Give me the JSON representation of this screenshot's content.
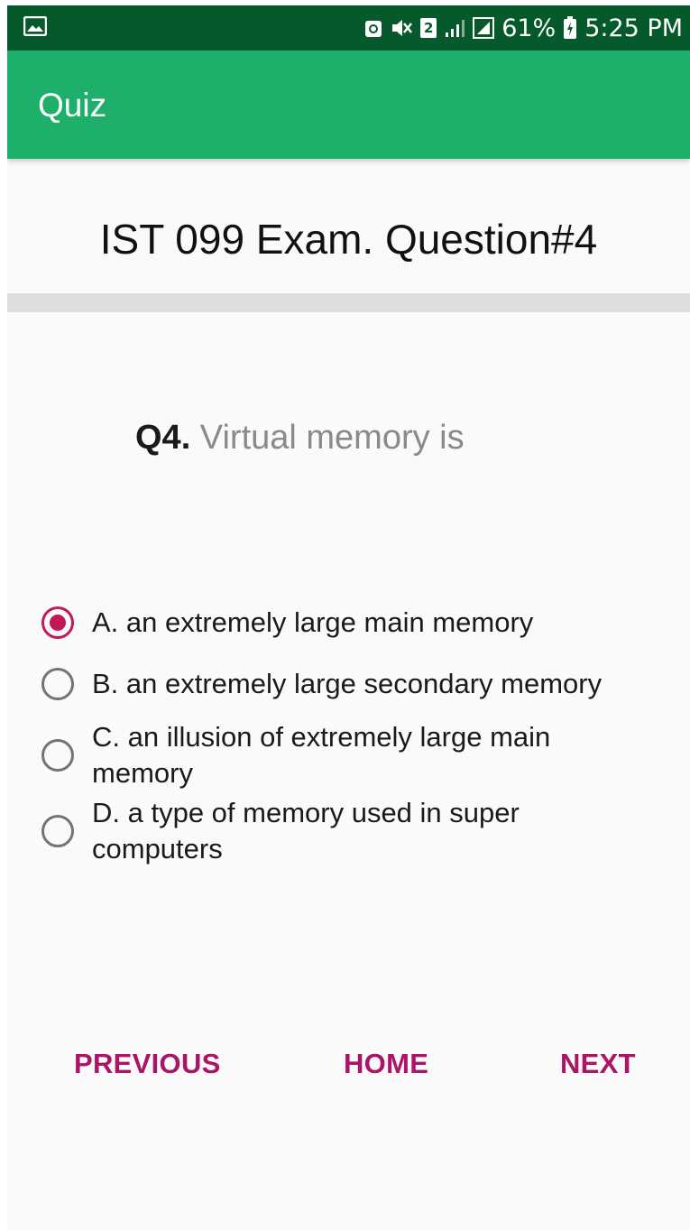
{
  "status_bar": {
    "battery": "61%",
    "time": "5:25 PM",
    "sim_badge": "2",
    "icons": [
      "image-icon",
      "recycle-icon",
      "mute-icon",
      "sim-icon",
      "signal-icon",
      "data-signal-icon",
      "battery-icon"
    ]
  },
  "app_bar": {
    "title": "Quiz"
  },
  "exam": {
    "title": "IST 099 Exam. Question#4"
  },
  "question": {
    "number": "Q4.",
    "text": " Virtual memory is"
  },
  "options": [
    {
      "label": "A. an extremely large main memory",
      "selected": true
    },
    {
      "label": "B. an extremely large secondary memory",
      "selected": false
    },
    {
      "label": "C. an illusion of extremely large main memory",
      "selected": false
    },
    {
      "label": "D. a type of memory used in super computers",
      "selected": false
    }
  ],
  "nav": {
    "previous": "PREVIOUS",
    "home": "HOME",
    "next": "NEXT"
  },
  "colors": {
    "status_bar": "#06592a",
    "app_bar": "#1eb06a",
    "accent": "#c2185b",
    "button": "#ad1467"
  }
}
